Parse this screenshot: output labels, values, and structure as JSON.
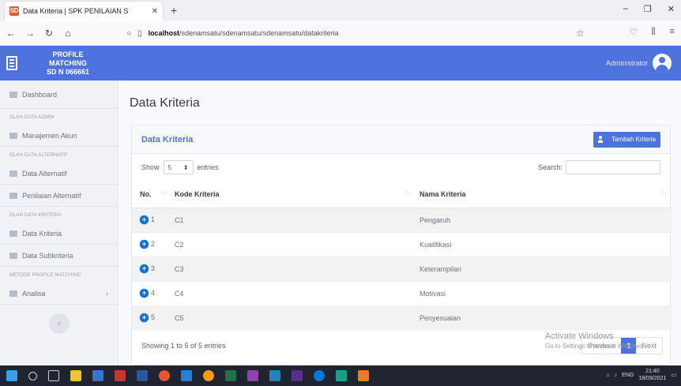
{
  "browser": {
    "tab_title": "Data Kriteria | SPK PENILAIAN S",
    "tab_favicon": "SD",
    "url_prefix": "localhost",
    "url_path": "/sdenamsatu/sdenamsatu/sdenamsatu/datakriteria"
  },
  "app": {
    "brand_line1": "PROFILE",
    "brand_line2": "MATCHING",
    "brand_line3": "SD N 066661",
    "user_name": "Administrator"
  },
  "sidebar": {
    "dashboard": "Dashboard",
    "head_admin": "OLAH DATA ADMIN",
    "akun": "Manajemen Akun",
    "head_alternatif": "OLAH DATA ALTERNATIF",
    "alternatif": "Data Alternatif",
    "penilaian": "Penilaian Alternatif",
    "head_kriteria": "OLAH DATA KRITERIA",
    "kriteria": "Data Kriteria",
    "subkriteria": "Data Subkriteria",
    "head_metode": "METODE PROFILE MATCHING",
    "analisa": "Analisa"
  },
  "main": {
    "page_title": "Data Kriteria",
    "card_title": "Data Kriteria",
    "add_button": "Tambah Kriteria",
    "show_label": "Show",
    "show_value": "5",
    "entries_label": "entries",
    "search_label": "Search:",
    "columns": [
      "No.",
      "Kode Kriteria",
      "Nama Kriteria"
    ],
    "rows": [
      {
        "no": "1",
        "kode": "C1",
        "nama": "Pengaruh"
      },
      {
        "no": "2",
        "kode": "C2",
        "nama": "Kualifikasi"
      },
      {
        "no": "3",
        "kode": "C3",
        "nama": "Keterampilan"
      },
      {
        "no": "4",
        "kode": "C4",
        "nama": "Motivasi"
      },
      {
        "no": "5",
        "kode": "C5",
        "nama": "Penyesuaian"
      }
    ],
    "info": "Showing 1 to 5 of 5 entries",
    "prev": "Previous",
    "page": "1",
    "next": "Next"
  },
  "watermark": {
    "line1": "Activate Windows",
    "line2": "Go to Settings to activate Windows."
  },
  "taskbar": {
    "time": "21:40",
    "date": "18/09/2021",
    "lang": "ENG"
  },
  "colors": {
    "primary": "#4e73df",
    "plus": "#0275d8"
  }
}
